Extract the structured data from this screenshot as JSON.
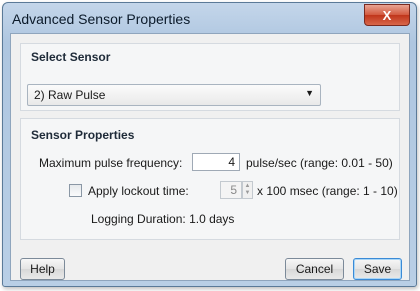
{
  "window": {
    "title": "Advanced Sensor Properties",
    "close_glyph": "X"
  },
  "select_sensor": {
    "heading": "Select Sensor",
    "selected_value": "2) Raw Pulse"
  },
  "sensor_properties": {
    "heading": "Sensor Properties",
    "max_pulse_label": "Maximum pulse frequency:",
    "max_pulse_value": "4",
    "max_pulse_unit": "pulse/sec (range: 0.01 - 50)",
    "lockout_label": "Apply lockout time:",
    "lockout_checked": false,
    "lockout_value": "5",
    "lockout_unit": "x 100 msec (range: 1 - 10)",
    "logging_duration": "Logging Duration: 1.0 days"
  },
  "buttons": {
    "help": "Help",
    "cancel": "Cancel",
    "save": "Save"
  },
  "icons": {
    "close": "close-icon",
    "dropdown": "chevron-down-icon",
    "spinner_up": "arrow-up-icon",
    "spinner_down": "arrow-down-icon"
  }
}
